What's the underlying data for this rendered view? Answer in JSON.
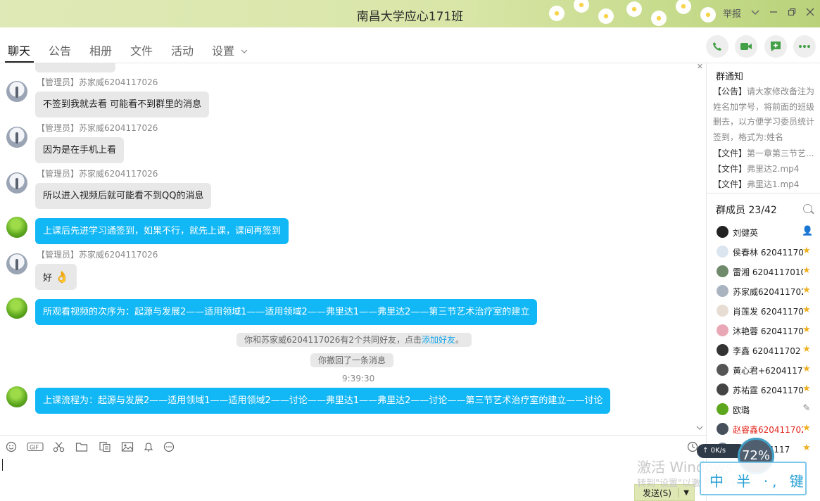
{
  "window": {
    "title": "南昌大学应心171班",
    "report_label": "举报",
    "colors": {
      "title_bar": "#d9e6a8",
      "accent_blue": "#12b7f5"
    }
  },
  "tabs": [
    {
      "label": "聊天",
      "active": true
    },
    {
      "label": "公告"
    },
    {
      "label": "相册"
    },
    {
      "label": "文件"
    },
    {
      "label": "活动"
    },
    {
      "label": "设置"
    }
  ],
  "header_icons": [
    "phone-icon",
    "video-call-icon",
    "add-chat-icon",
    "more-icon"
  ],
  "messages": [
    {
      "sender": "【管理员】苏家威6204117026",
      "text": "不签到我就去看 可能看不到群里的消息",
      "style": "grey"
    },
    {
      "sender": "【管理员】苏家威6204117026",
      "text": "因为是在手机上看",
      "style": "grey"
    },
    {
      "sender": "【管理员】苏家威6204117026",
      "text": "所以进入视频后就可能看不到QQ的消息",
      "style": "grey"
    },
    {
      "sender": "",
      "text": "上课后先进学习通签到，如果不行，就先上课，课间再签到",
      "style": "blue"
    },
    {
      "sender": "【管理员】苏家威6204117026",
      "text": "好",
      "style": "grey",
      "emoji": "👌"
    },
    {
      "sender": "",
      "text": "所观看视频的次序为：起源与发展2——适用领域1——适用领域2——弗里达1——弗里达2——第三节艺术治疗室的建立",
      "style": "blue"
    },
    {
      "sender": "",
      "text": "上课流程为：起源与发展2——适用领域1——适用领域2——讨论——弗里达1——弗里达2——讨论——第三节艺术治疗室的建立——讨论",
      "style": "blue"
    }
  ],
  "system": {
    "common_friends": "你和苏家威6204117026有2个共同好友，点击",
    "add_friend_link": "添加好友",
    "period": "。",
    "recalled": "你撤回了一条消息",
    "time": "9:39:30"
  },
  "toolbar_icons": [
    "emoji-icon",
    "gif-icon",
    "scissors-icon",
    "folder-icon",
    "doc-icon",
    "image-icon",
    "bell-icon",
    "more-icon",
    "history-icon"
  ],
  "send": {
    "label": "发送(S)"
  },
  "notice": {
    "title": "群通知",
    "announcement_tag": "【公告】",
    "announcement": "请大家修改备注为姓名加学号，将前面的班级删去，以方便学习委员统计签到，格式为:姓名",
    "files": [
      {
        "tag": "【文件】",
        "name": "第一章第三节艺..."
      },
      {
        "tag": "【文件】",
        "name": "弗里达2.mp4"
      },
      {
        "tag": "【文件】",
        "name": "弗里达1.mp4"
      }
    ]
  },
  "members": {
    "title": "群成员 23/42",
    "list": [
      {
        "name": "刘健英",
        "badge": "owner",
        "red": false
      },
      {
        "name": "侯春林 62041170",
        "badge": "admin",
        "red": false
      },
      {
        "name": "雷湘 6204117010",
        "badge": "admin",
        "red": false
      },
      {
        "name": "苏家威620411702",
        "badge": "admin",
        "red": false
      },
      {
        "name": "肖莲发 62041170",
        "badge": "admin",
        "red": false
      },
      {
        "name": "沐艳蓉 62041170",
        "badge": "admin",
        "red": false
      },
      {
        "name": "李鑫 620411702",
        "badge": "admin",
        "red": false
      },
      {
        "name": "黄心君+62041170",
        "badge": "admin",
        "red": false
      },
      {
        "name": "苏祐霆 62041170",
        "badge": "admin",
        "red": false
      },
      {
        "name": "欧璐",
        "badge": "edit",
        "red": false
      },
      {
        "name": "赵睿鑫620411702",
        "badge": "star",
        "red": true
      },
      {
        "name": "文诗 6204117",
        "badge": "star",
        "red": false
      }
    ]
  },
  "overlays": {
    "net_speed": "0K/s",
    "net_percent": "72%",
    "watermark_line1": "激活 Windows",
    "watermark_line2": "转到\"设置\"以激活 Windows。",
    "ime_text": "中 半 ·, 键"
  }
}
